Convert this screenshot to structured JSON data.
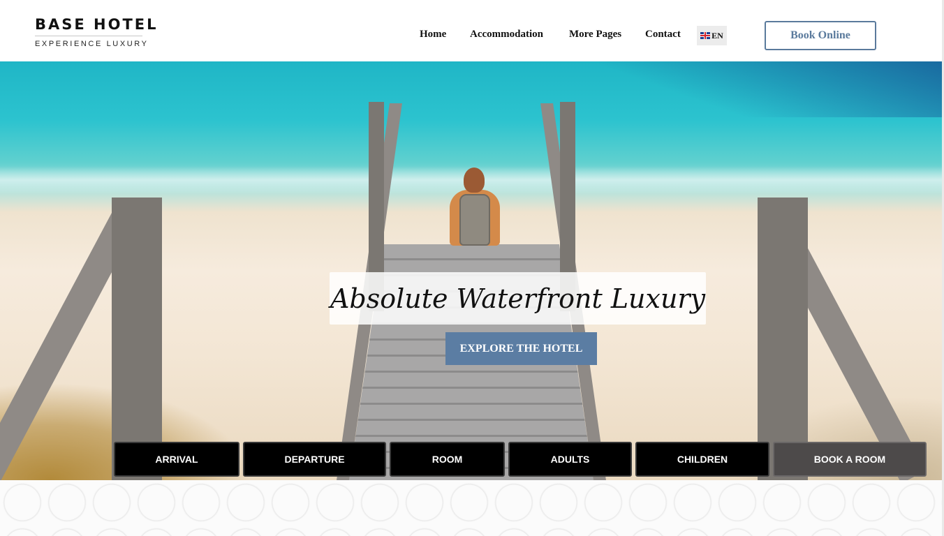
{
  "brand": {
    "title": "BASE HOTEL",
    "subtitle": "EXPERIENCE LUXURY"
  },
  "nav": {
    "items": [
      "Home",
      "Accommodation",
      "More Pages",
      "Contact"
    ]
  },
  "language": {
    "code": "EN",
    "flag_icon": "uk-flag-icon"
  },
  "header": {
    "book_online": "Book Online"
  },
  "hero": {
    "headline": "Absolute Waterfront Luxury",
    "cta": "EXPLORE THE HOTEL"
  },
  "booking": {
    "arrival": "ARRIVAL",
    "departure": "DEPARTURE",
    "room": "ROOM",
    "adults": "ADULTS",
    "children": "CHILDREN",
    "book": "BOOK A ROOM"
  },
  "colors": {
    "accent": "#5b7da3",
    "book_outline": "#5a7a9c",
    "bar_bg": "#000000",
    "book_room_bg": "#4d4a4a"
  }
}
